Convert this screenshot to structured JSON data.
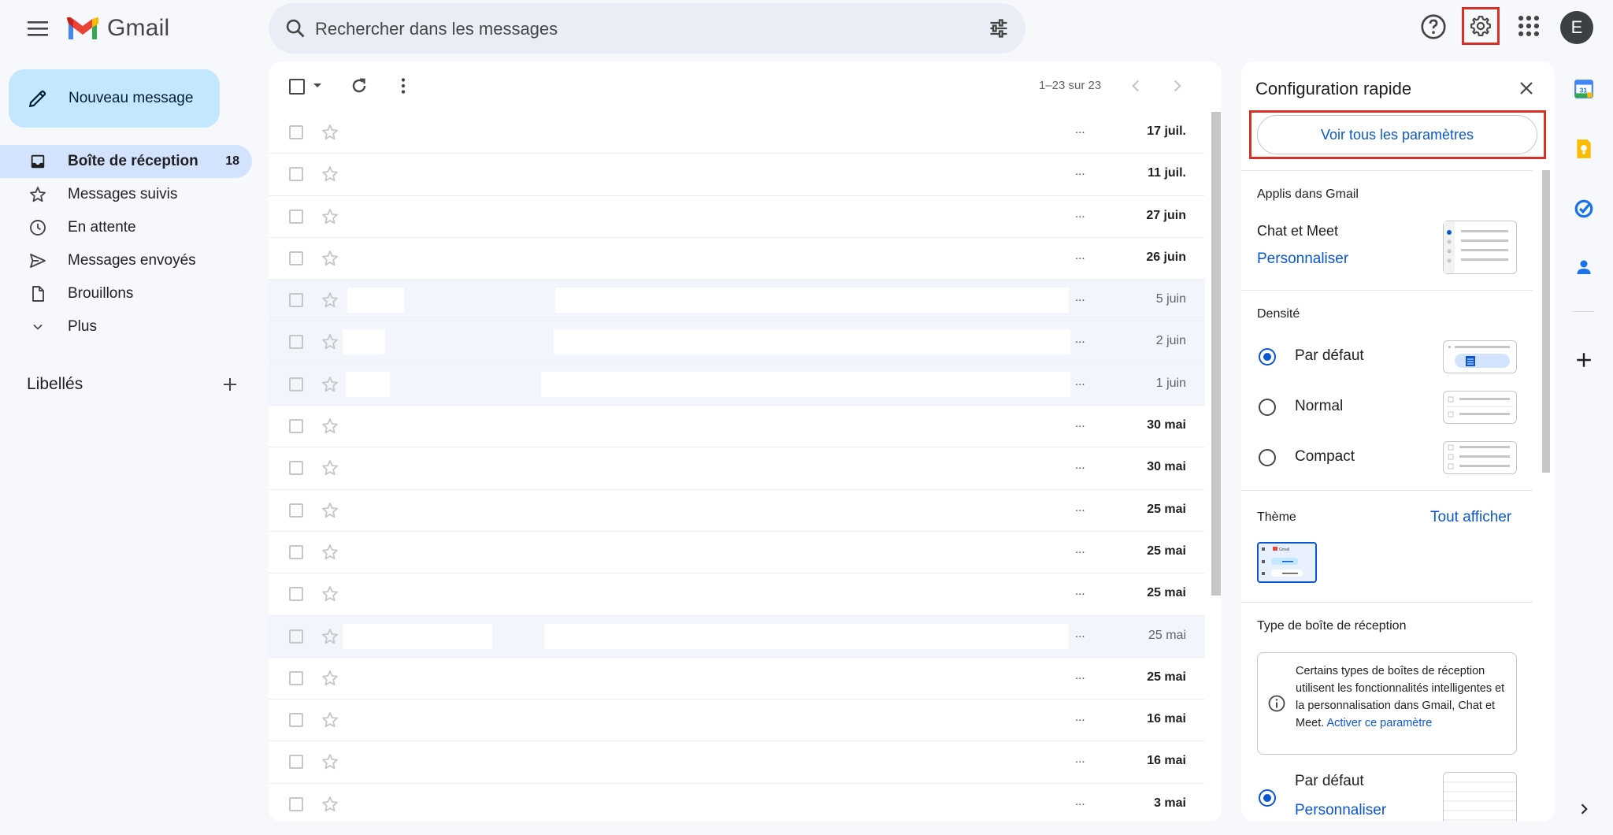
{
  "header": {
    "logo_text": "Gmail",
    "search_placeholder": "Rechercher dans les messages",
    "avatar_letter": "E"
  },
  "sidebar": {
    "compose_label": "Nouveau message",
    "items": [
      {
        "label": "Boîte de réception",
        "count": "18",
        "icon": "inbox-icon",
        "active": true
      },
      {
        "label": "Messages suivis",
        "icon": "star-icon"
      },
      {
        "label": "En attente",
        "icon": "clock-icon"
      },
      {
        "label": "Messages envoyés",
        "icon": "send-icon"
      },
      {
        "label": "Brouillons",
        "icon": "draft-icon"
      },
      {
        "label": "Plus",
        "icon": "chevron-down-icon"
      }
    ],
    "labels_heading": "Libellés"
  },
  "mail": {
    "pager_text": "1–23 sur 23",
    "rows": [
      {
        "date": "17 juil.",
        "unread": true
      },
      {
        "date": "11 juil.",
        "unread": true
      },
      {
        "date": "27 juin",
        "unread": true
      },
      {
        "date": "26 juin",
        "unread": true
      },
      {
        "date": "5 juin",
        "unread": false
      },
      {
        "date": "2 juin",
        "unread": false
      },
      {
        "date": "1 juin",
        "unread": false
      },
      {
        "date": "30 mai",
        "unread": true
      },
      {
        "date": "30 mai",
        "unread": true
      },
      {
        "date": "25 mai",
        "unread": true
      },
      {
        "date": "25 mai",
        "unread": true
      },
      {
        "date": "25 mai",
        "unread": true
      },
      {
        "date": "25 mai",
        "unread": false
      },
      {
        "date": "25 mai",
        "unread": true
      },
      {
        "date": "16 mai",
        "unread": true
      },
      {
        "date": "16 mai",
        "unread": true
      },
      {
        "date": "3 mai",
        "unread": true
      }
    ],
    "ellipsis": "..."
  },
  "quick_settings": {
    "title": "Configuration rapide",
    "all_settings_button": "Voir tous les paramètres",
    "apps_heading": "Applis dans Gmail",
    "apps_item": "Chat et Meet",
    "apps_customize": "Personnaliser",
    "density_heading": "Densité",
    "density_options": [
      "Par défaut",
      "Normal",
      "Compact"
    ],
    "density_selected": "Par défaut",
    "theme_heading": "Thème",
    "theme_show_all": "Tout afficher",
    "theme_thumb_label": "Gmail",
    "inbox_type_heading": "Type de boîte de réception",
    "inbox_info_text": "Certains types de boîtes de réception utilisent les fonctionnalités intelligentes et la personnalisation dans Gmail, Chat et Meet.",
    "inbox_info_link": "Activer ce paramètre",
    "inbox_type_option": "Par défaut",
    "inbox_type_customize": "Personnaliser"
  },
  "colors": {
    "accent": "#0b57d0",
    "highlight_border": "#d93025",
    "compose_bg": "#c2e7ff",
    "active_nav_bg": "#d3e3fd"
  }
}
